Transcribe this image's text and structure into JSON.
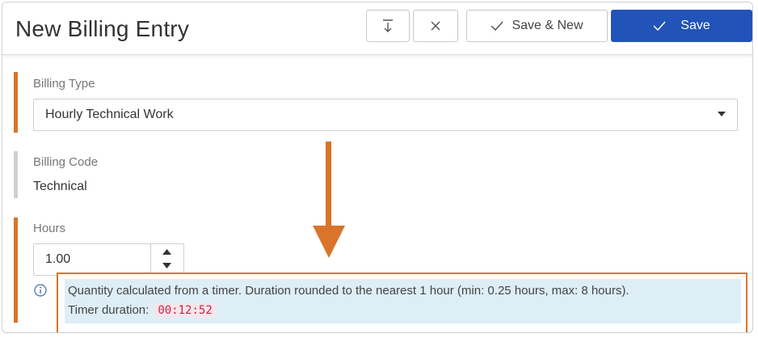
{
  "header": {
    "title": "New Billing Entry",
    "buttons": {
      "collapse_icon": "collapse-down-icon",
      "close_icon": "close-icon",
      "save_new_label": "Save & New",
      "save_label": "Save"
    }
  },
  "fields": {
    "billing_type": {
      "label": "Billing Type",
      "value": "Hourly Technical Work"
    },
    "billing_code": {
      "label": "Billing Code",
      "value": "Technical"
    },
    "hours": {
      "label": "Hours",
      "value": "1.00"
    }
  },
  "info": {
    "line1": "Quantity calculated from a timer. Duration rounded to the nearest 1 hour (min: 0.25 hours, max: 8 hours).",
    "line2_label": "Timer duration:",
    "timer_value": "00:12:52"
  },
  "colors": {
    "accent_orange": "#d9742a",
    "primary_blue": "#2153b8",
    "info_bg": "#ddeef6",
    "code_red": "#c7254e"
  }
}
